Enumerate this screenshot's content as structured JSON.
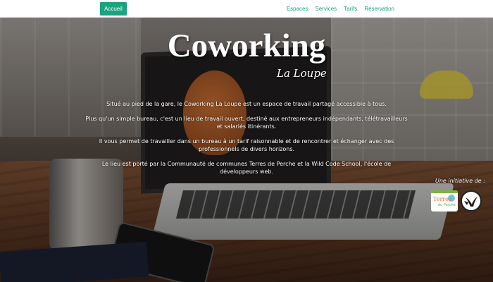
{
  "nav": {
    "home": "Accueil",
    "links": [
      "Espaces",
      "Services",
      "Tarifs",
      "Réservation"
    ]
  },
  "hero": {
    "title": "Coworking",
    "subtitle": "La Loupe",
    "paragraphs": [
      "Situé au pied de la gare, le Coworking La Loupe est un espace de travail partagé accessible à tous.",
      "Plus qu'un simple bureau, c'est un lieu de travail ouvert, destiné aux entrepreneurs indépendants, télétravailleurs et salariés itinérants.",
      "Il vous permet de travailler dans un bureau à un tarif raisonnable et de rencontrer et échanger avec des professionnels de divers horizons.",
      "Le lieu est porté par la Communauté de communes Terres de Perche et la Wild Code School, l'école de développeurs web."
    ]
  },
  "initiative": {
    "label": "Une initiative de :",
    "logos": [
      {
        "name": "terres-de-perche-logo",
        "text_a": "Terres",
        "text_b": "du Perche"
      },
      {
        "name": "wild-code-school-logo"
      }
    ]
  },
  "colors": {
    "accent": "#1aa37f",
    "nav_bg": "#ffffff"
  }
}
